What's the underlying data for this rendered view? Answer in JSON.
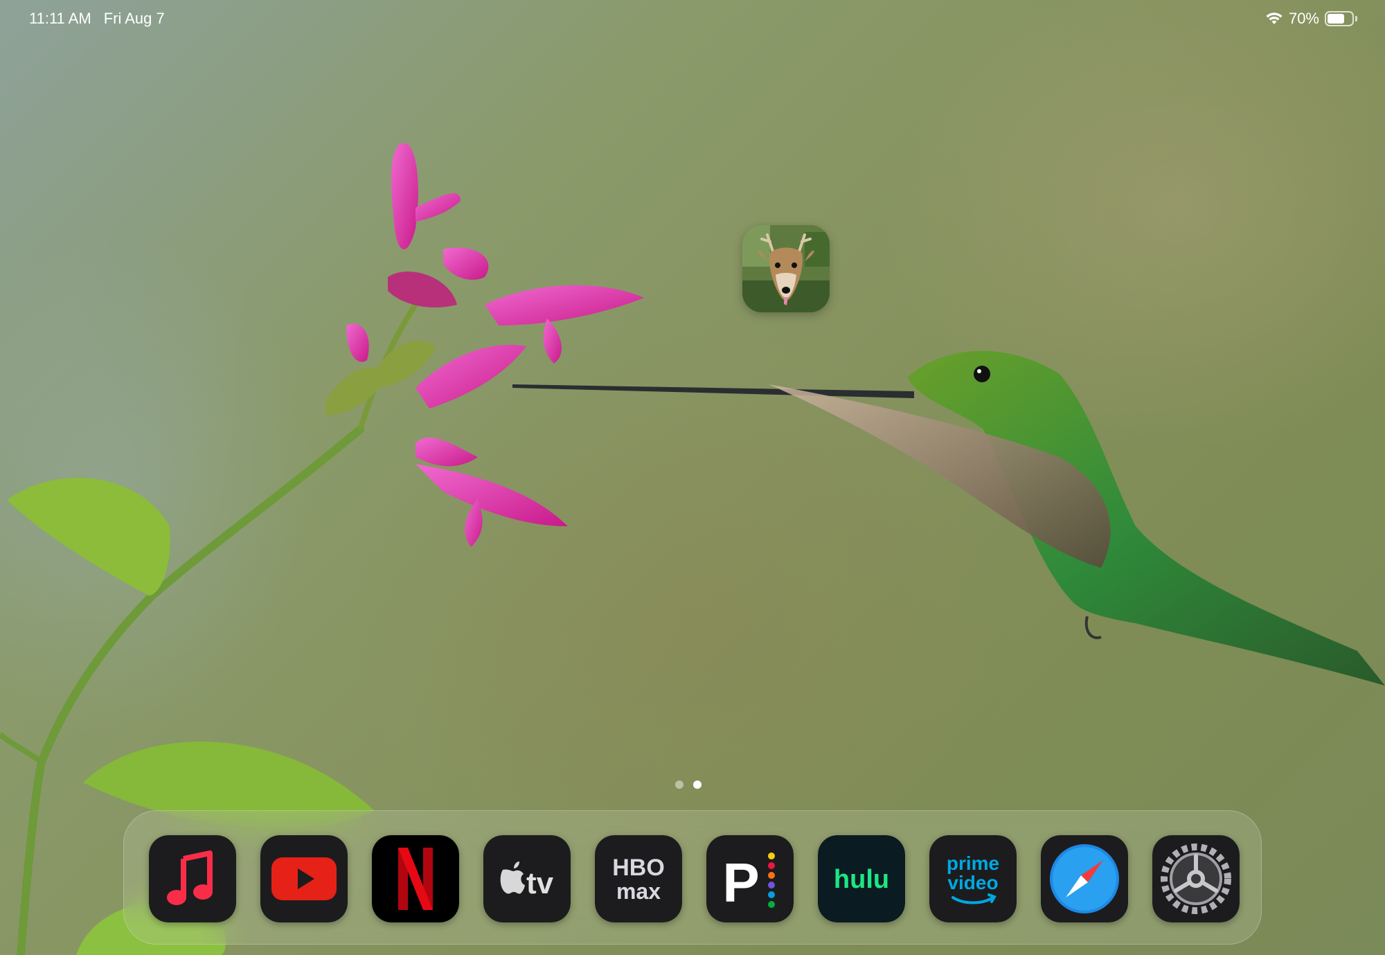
{
  "status_bar": {
    "time": "11:11 AM",
    "date": "Fri Aug 7",
    "wifi_icon": "wifi-icon",
    "battery_percent": "70%",
    "battery_level": 0.7
  },
  "home_screen": {
    "wallpaper": "hummingbird-and-pink-flower",
    "app_icons": [
      {
        "name": "Deer",
        "icon": "deer-photo-icon"
      }
    ],
    "page_indicator": {
      "pages": 2,
      "current": 2
    }
  },
  "dock": {
    "apps": [
      {
        "name": "Music",
        "icon": "music-note-icon",
        "bg": "#1c1c1e",
        "accent": "#fa2d48"
      },
      {
        "name": "YouTube",
        "icon": "youtube-play-icon",
        "bg": "#1c1c1e",
        "accent": "#e62117"
      },
      {
        "name": "Netflix",
        "icon": "netflix-n-icon",
        "bg": "#000000",
        "accent": "#e50914"
      },
      {
        "name": "TV",
        "icon": "apple-tv-icon",
        "bg": "#1c1c1e",
        "glyph_text": "tv"
      },
      {
        "name": "HBO Max",
        "icon": "hbo-max-icon",
        "bg": "#1c1c1e",
        "glyph_top": "HBO",
        "glyph_bottom": "max"
      },
      {
        "name": "Peacock",
        "icon": "peacock-icon",
        "bg": "#1c1c1e",
        "glyph_text": "P"
      },
      {
        "name": "Hulu",
        "icon": "hulu-icon",
        "bg": "#0b1b22",
        "glyph_text": "hulu",
        "accent": "#1ce783"
      },
      {
        "name": "Prime Video",
        "icon": "prime-video-icon",
        "bg": "#1c1c1e",
        "glyph_top": "prime",
        "glyph_bottom": "video",
        "accent": "#00a8e1"
      },
      {
        "name": "Safari",
        "icon": "safari-compass-icon",
        "bg": "#1c1c1e",
        "accent": "#1e88e5"
      },
      {
        "name": "Settings",
        "icon": "settings-gear-icon",
        "bg": "#1c1c1e"
      }
    ]
  }
}
